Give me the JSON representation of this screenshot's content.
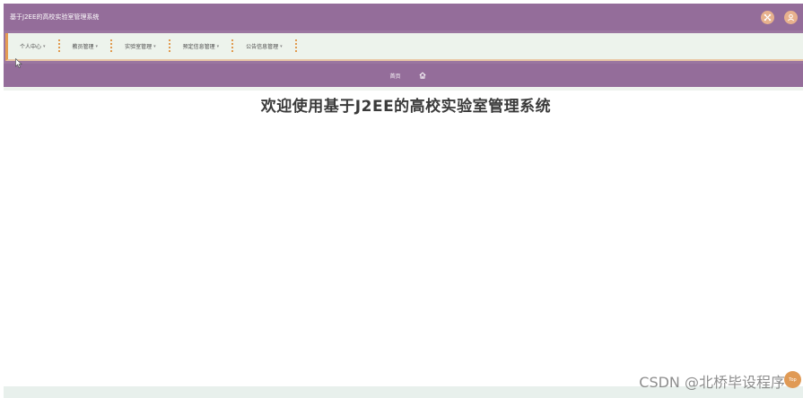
{
  "header": {
    "app_title": "基于J2EE的高校实验室管理系统",
    "icons": [
      "network-icon",
      "user-icon"
    ]
  },
  "nav": {
    "items": [
      {
        "label": "个人中心"
      },
      {
        "label": "教员管理"
      },
      {
        "label": "实验室管理"
      },
      {
        "label": "预定信息管理"
      },
      {
        "label": "公告信息管理"
      }
    ]
  },
  "breadcrumb": {
    "home_label": "首页",
    "icon": "home-icon"
  },
  "main": {
    "welcome_title": "欢迎使用基于J2EE的高校实验室管理系统"
  },
  "watermark": {
    "text": "CSDN @北桥毕设程序"
  },
  "back_to_top": {
    "label": "Top"
  },
  "colors": {
    "purple": "#946d9a",
    "orange": "#e09a4f",
    "nav_bg": "#edf3ec"
  }
}
